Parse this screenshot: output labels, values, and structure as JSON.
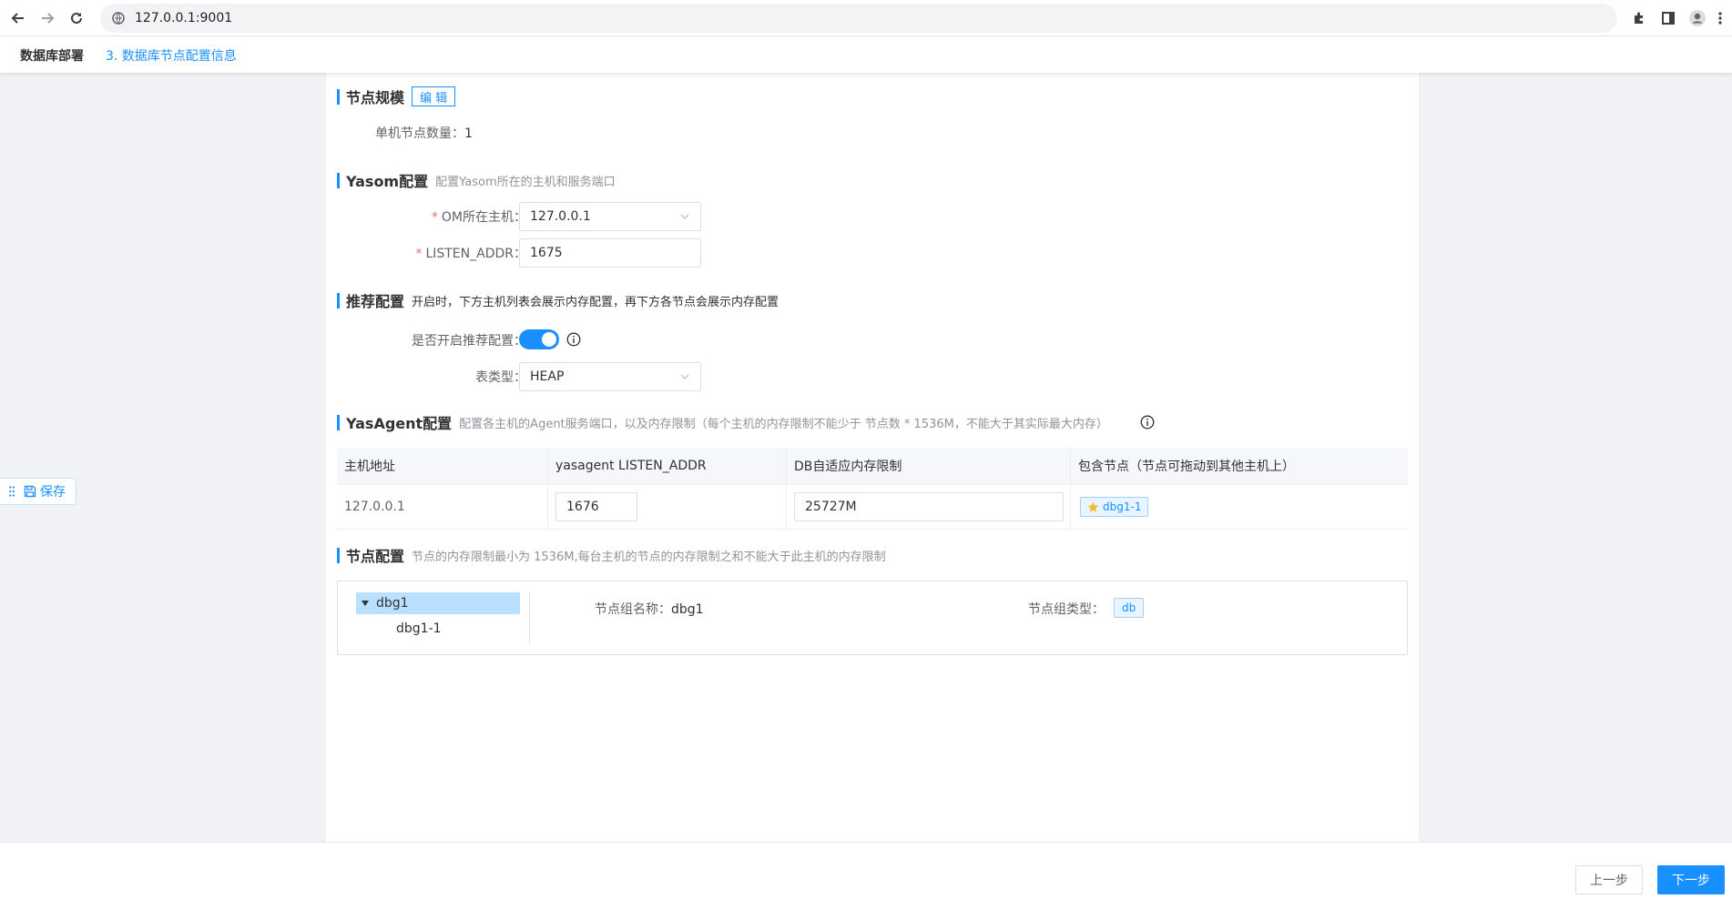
{
  "browser": {
    "url": "127.0.0.1:9001"
  },
  "header": {
    "title": "数据库部署",
    "step": "3. 数据库节点配置信息"
  },
  "node_scale": {
    "title": "节点规模",
    "edit_label": "编 辑",
    "count_label": "单机节点数量：",
    "count_value": "1"
  },
  "yasom": {
    "title": "Yasom配置",
    "desc": "配置Yasom所在的主机和服务端口",
    "host_label": "OM所在主机：",
    "host_value": "127.0.0.1",
    "listen_label": "LISTEN_ADDR：",
    "listen_value": "1675"
  },
  "recommend": {
    "title": "推荐配置",
    "desc": "开启时，下方主机列表会展示内存配置，再下方各节点会展示内存配置",
    "enable_label": "是否开启推荐配置：",
    "enabled": true,
    "table_type_label": "表类型：",
    "table_type_value": "HEAP"
  },
  "yasagent": {
    "title": "YasAgent配置",
    "desc": "配置各主机的Agent服务端口，以及内存限制（每个主机的内存限制不能少于 节点数 * 1536M，不能大于其实际最大内存）",
    "columns": [
      "主机地址",
      "yasagent LISTEN_ADDR",
      "DB自适应内存限制",
      "包含节点（节点可拖动到其他主机上）"
    ],
    "rows": [
      {
        "host": "127.0.0.1",
        "listen_addr": "1676",
        "mem_limit": "25727M",
        "node": "dbg1-1"
      }
    ]
  },
  "node_config": {
    "title": "节点配置",
    "desc": "节点的内存限制最小为 1536M,每台主机的节点的内存限制之和不能大于此主机的内存限制",
    "tree": [
      {
        "label": "dbg1",
        "children": [
          "dbg1-1"
        ]
      }
    ],
    "group_name_label": "节点组名称：",
    "group_name_value": "dbg1",
    "group_type_label": "节点组类型：",
    "group_type_value": "db"
  },
  "float_save": {
    "label": "保存"
  },
  "footer": {
    "prev_label": "上一步",
    "next_label": "下一步"
  },
  "colors": {
    "primary": "#1890ff",
    "required": "#f56c6c",
    "selected_tree": "#bae0ff"
  }
}
